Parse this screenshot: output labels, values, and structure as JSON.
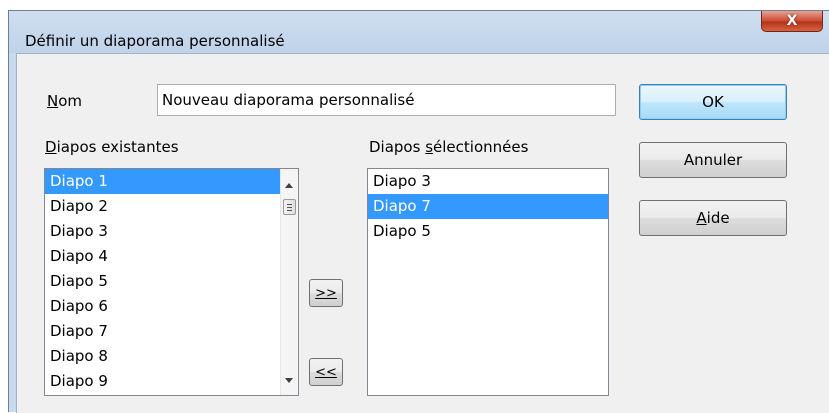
{
  "window": {
    "title": "Définir un diaporama personnalisé",
    "close_label": "X"
  },
  "name_field": {
    "label": "Nom",
    "value": "Nouveau diaporama personnalisé"
  },
  "existing": {
    "label": "Diapos existantes",
    "items": [
      "Diapo 1",
      "Diapo 2",
      "Diapo 3",
      "Diapo 4",
      "Diapo 5",
      "Diapo 6",
      "Diapo 7",
      "Diapo 8",
      "Diapo 9"
    ],
    "selected_index": 0
  },
  "selected": {
    "label": "Diapos sélectionnées",
    "items": [
      "Diapo 3",
      "Diapo 7",
      "Diapo 5"
    ],
    "selected_index": 1
  },
  "buttons": {
    "add": ">>",
    "remove": "<<",
    "ok": "OK",
    "cancel": "Annuler",
    "help": "Aide"
  }
}
